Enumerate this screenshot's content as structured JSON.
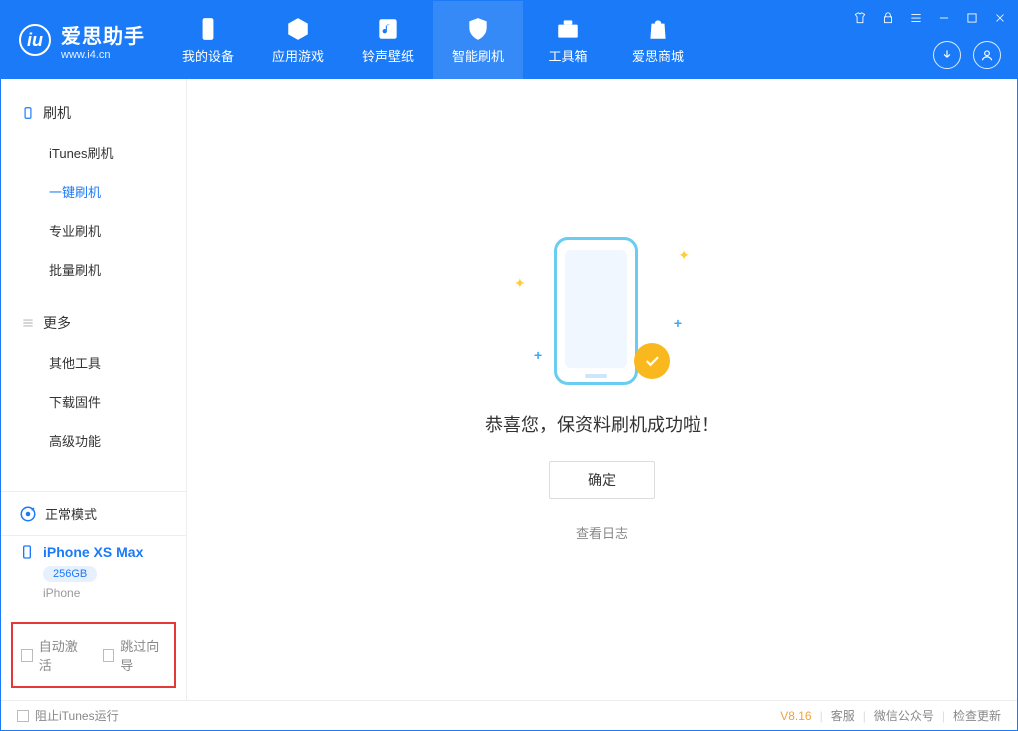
{
  "app": {
    "name": "爱思助手",
    "url": "www.i4.cn"
  },
  "nav": {
    "items": [
      {
        "label": "我的设备",
        "icon": "device"
      },
      {
        "label": "应用游戏",
        "icon": "cube"
      },
      {
        "label": "铃声壁纸",
        "icon": "music"
      },
      {
        "label": "智能刷机",
        "icon": "shield"
      },
      {
        "label": "工具箱",
        "icon": "toolbox"
      },
      {
        "label": "爱思商城",
        "icon": "bag"
      }
    ],
    "active_index": 3
  },
  "sidebar": {
    "groups": [
      {
        "title": "刷机",
        "items": [
          "iTunes刷机",
          "一键刷机",
          "专业刷机",
          "批量刷机"
        ],
        "active_index": 1
      },
      {
        "title": "更多",
        "items": [
          "其他工具",
          "下载固件",
          "高级功能"
        ],
        "active_index": -1
      }
    ]
  },
  "device": {
    "mode_label": "正常模式",
    "name": "iPhone XS Max",
    "capacity": "256GB",
    "type": "iPhone"
  },
  "options": {
    "auto_activate_label": "自动激活",
    "skip_guide_label": "跳过向导"
  },
  "main": {
    "success_message": "恭喜您，保资料刷机成功啦！",
    "ok_button": "确定",
    "view_log": "查看日志"
  },
  "statusbar": {
    "block_itunes_label": "阻止iTunes运行",
    "version": "V8.16",
    "links": [
      "客服",
      "微信公众号",
      "检查更新"
    ]
  }
}
